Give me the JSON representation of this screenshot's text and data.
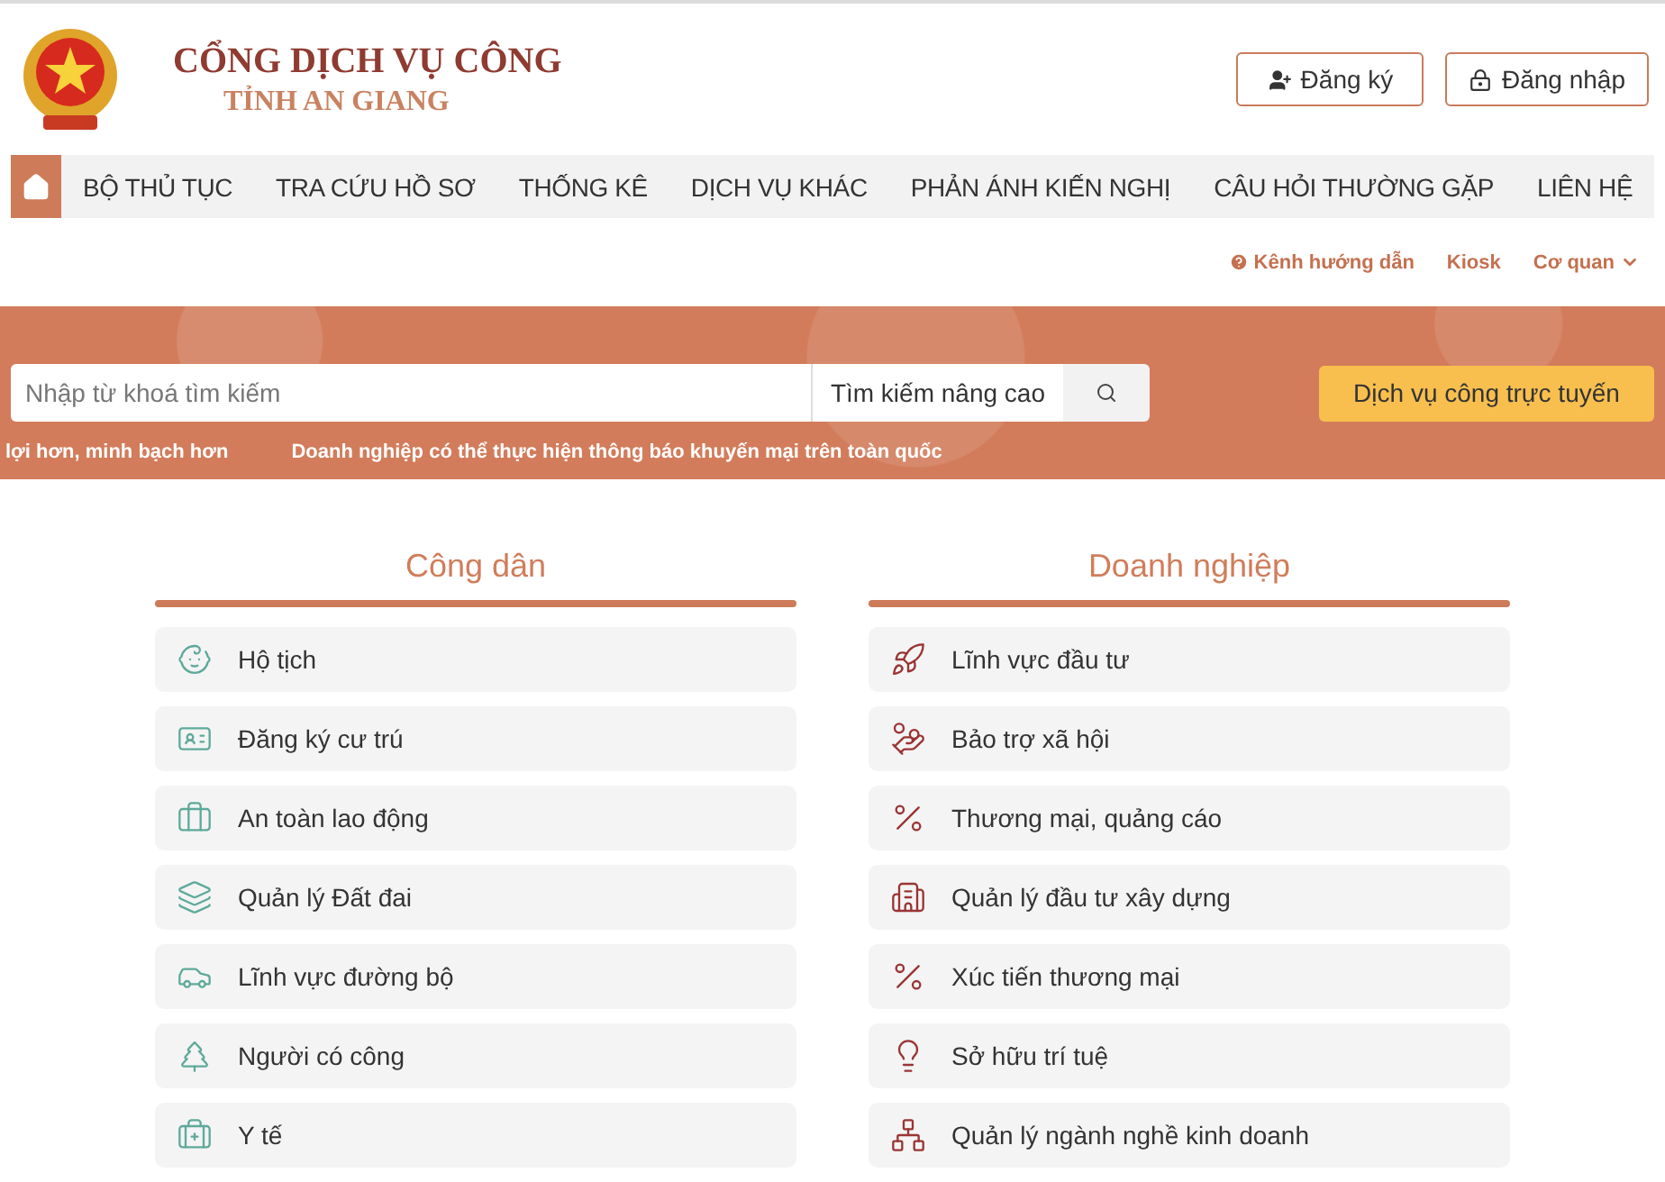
{
  "header": {
    "logo_title": "CỔNG DỊCH VỤ CÔNG",
    "logo_subtitle": "TỈNH AN GIANG",
    "buttons": [
      {
        "kind": "register",
        "label": "Đăng ký"
      },
      {
        "kind": "login",
        "label": "Đăng nhập"
      }
    ]
  },
  "nav": {
    "home": {
      "selected": true
    },
    "items": [
      {
        "label": "BỘ THỦ TỤC",
        "selected": false
      },
      {
        "label": "TRA CỨU HỒ SƠ",
        "selected": false
      },
      {
        "label": "THỐNG KÊ",
        "selected": false
      },
      {
        "label": "DỊCH VỤ KHÁC",
        "selected": false
      },
      {
        "label": "PHẢN ÁNH KIẾN NGHỊ",
        "selected": false
      },
      {
        "label": "CÂU HỎI THƯỜNG GẶP",
        "selected": false
      },
      {
        "label": "LIÊN HỆ",
        "selected": false
      }
    ]
  },
  "sublinks": [
    {
      "kind": "help",
      "label": "Kênh hướng dẫn"
    },
    {
      "kind": "plain",
      "label": "Kiosk"
    },
    {
      "kind": "dropdown",
      "label": "Cơ quan"
    }
  ],
  "search": {
    "placeholder": "Nhập từ khoá tìm kiếm",
    "advanced": "Tìm kiếm nâng cao",
    "online_button": "Dịch vụ công trực tuyến"
  },
  "ticker": [
    "lợi hơn, minh bạch hơn",
    "Doanh nghiệp có thể thực hiện thông báo khuyến mại trên toàn quốc"
  ],
  "sections": [
    {
      "title": "Công dân",
      "items": [
        "Hộ tịch",
        "Đăng ký cư trú",
        "An toàn lao động",
        "Quản lý Đất đai",
        "Lĩnh vực đường bộ",
        "Người có công",
        "Y tế"
      ]
    },
    {
      "title": "Doanh nghiệp",
      "items": [
        "Lĩnh vực đầu tư",
        "Bảo trợ xã hội",
        "Thương mại, quảng cáo",
        "Quản lý đầu tư xây dựng",
        "Xúc tiến thương mại",
        "Sở hữu trí tuệ",
        "Quản lý ngành nghề kinh doanh"
      ]
    }
  ]
}
